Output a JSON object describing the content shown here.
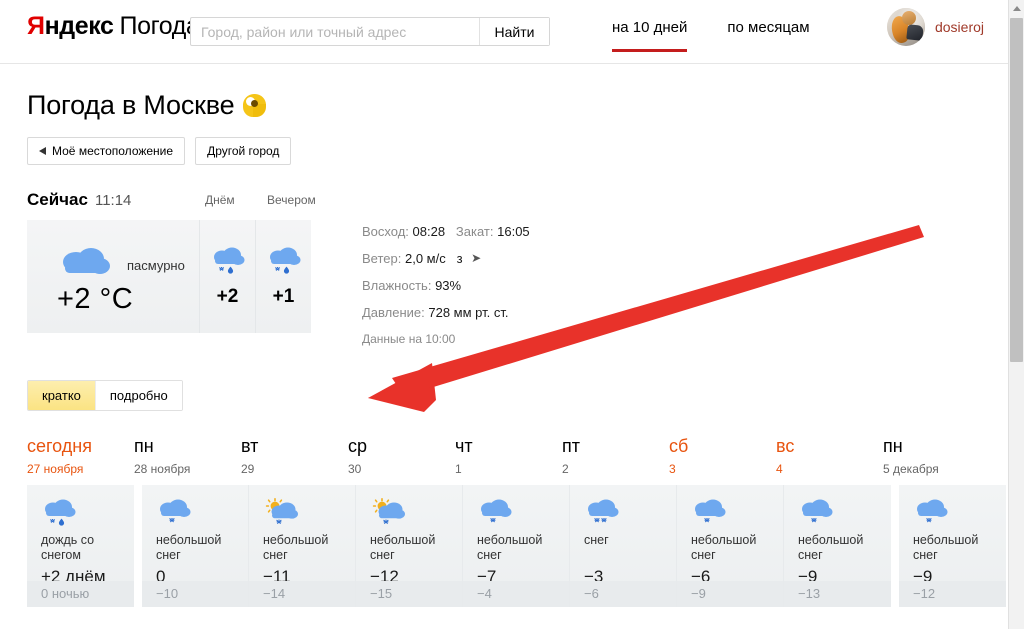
{
  "header": {
    "logo": {
      "ya": "Я",
      "ndeks": "ндекс",
      "pogoda": "Погода"
    },
    "search": {
      "value": "",
      "placeholder": "Город, район или точный адрес",
      "button": "Найти"
    },
    "nav": [
      {
        "label": "на 10 дней",
        "active": true
      },
      {
        "label": "по месяцам",
        "active": false
      }
    ],
    "user": {
      "name": "dosieroj",
      "avatar_icon": "user-avatar-photo"
    }
  },
  "title": {
    "text": "Погода в Москве",
    "badge_icon": "yandex-weather-badge-icon"
  },
  "location_buttons": [
    {
      "label": "Моё местоположение",
      "icon": "arrow-left-icon"
    },
    {
      "label": "Другой город",
      "icon": ""
    }
  ],
  "now": {
    "label": "Сейчас",
    "time": "11:14",
    "condition": "пасмурно",
    "temp": "+2 °C",
    "icon": "cloud-overcast-icon",
    "parts": [
      {
        "label": "Днём",
        "temp": "+2",
        "icon": "cloud-rain-snow-icon"
      },
      {
        "label": "Вечером",
        "temp": "+1",
        "icon": "cloud-rain-snow-icon"
      }
    ]
  },
  "facts": {
    "sunrise_label": "Восход:",
    "sunrise_value": "08:28",
    "sunset_label": "Закат:",
    "sunset_value": "16:05",
    "wind_label": "Ветер:",
    "wind_value": "2,0 м/с",
    "wind_dir": "з",
    "wind_dir_icon": "wind-direction-arrow-icon",
    "humidity_label": "Влажность:",
    "humidity_value": "93%",
    "pressure_label": "Давление:",
    "pressure_value": "728 мм рт. ст.",
    "updated": "Данные на 10:00"
  },
  "view_tabs": [
    {
      "label": "кратко",
      "active": true
    },
    {
      "label": "подробно",
      "active": false
    }
  ],
  "forecast": {
    "days": [
      {
        "dow": "сегодня",
        "date": "27 ноября",
        "accent": true,
        "condition": "дождь со снегом",
        "icon": "cloud-rain-snow-icon",
        "day_temp": "+2 днём",
        "night_temp": "0 ночью"
      },
      {
        "dow": "пн",
        "date": "28 ноября",
        "accent": false,
        "condition": "небольшой снег",
        "icon": "cloud-light-snow-icon",
        "day_temp": "0",
        "night_temp": "−10"
      },
      {
        "dow": "вт",
        "date": "29",
        "accent": false,
        "condition": "небольшой снег",
        "icon": "sun-cloud-light-snow-icon",
        "day_temp": "−11",
        "night_temp": "−14"
      },
      {
        "dow": "ср",
        "date": "30",
        "accent": false,
        "condition": "небольшой снег",
        "icon": "sun-cloud-light-snow-icon",
        "day_temp": "−12",
        "night_temp": "−15"
      },
      {
        "dow": "чт",
        "date": "1",
        "accent": false,
        "condition": "небольшой снег",
        "icon": "cloud-light-snow-icon",
        "day_temp": "−7",
        "night_temp": "−4"
      },
      {
        "dow": "пт",
        "date": "2",
        "accent": false,
        "condition": "снег",
        "icon": "cloud-snow-icon",
        "day_temp": "−3",
        "night_temp": "−6"
      },
      {
        "dow": "сб",
        "date": "3",
        "accent": true,
        "condition": "небольшой снег",
        "icon": "cloud-light-snow-icon",
        "day_temp": "−6",
        "night_temp": "−9"
      },
      {
        "dow": "вс",
        "date": "4",
        "accent": true,
        "condition": "небольшой снег",
        "icon": "cloud-light-snow-icon",
        "day_temp": "−9",
        "night_temp": "−13"
      },
      {
        "dow": "пн",
        "date": "5 декабря",
        "accent": false,
        "condition": "небольшой снег",
        "icon": "cloud-light-snow-icon",
        "day_temp": "−9",
        "night_temp": "−12"
      }
    ]
  },
  "annotation": {
    "arrow_icon": "red-annotation-arrow-icon",
    "color": "#e8322a"
  },
  "colors": {
    "brand_red": "#e00000",
    "accent_orange": "#e8540f",
    "tab_yellow": "#fbe383",
    "cloud_blue": "#6ea8ef",
    "nav_underline": "#c41d1d"
  }
}
